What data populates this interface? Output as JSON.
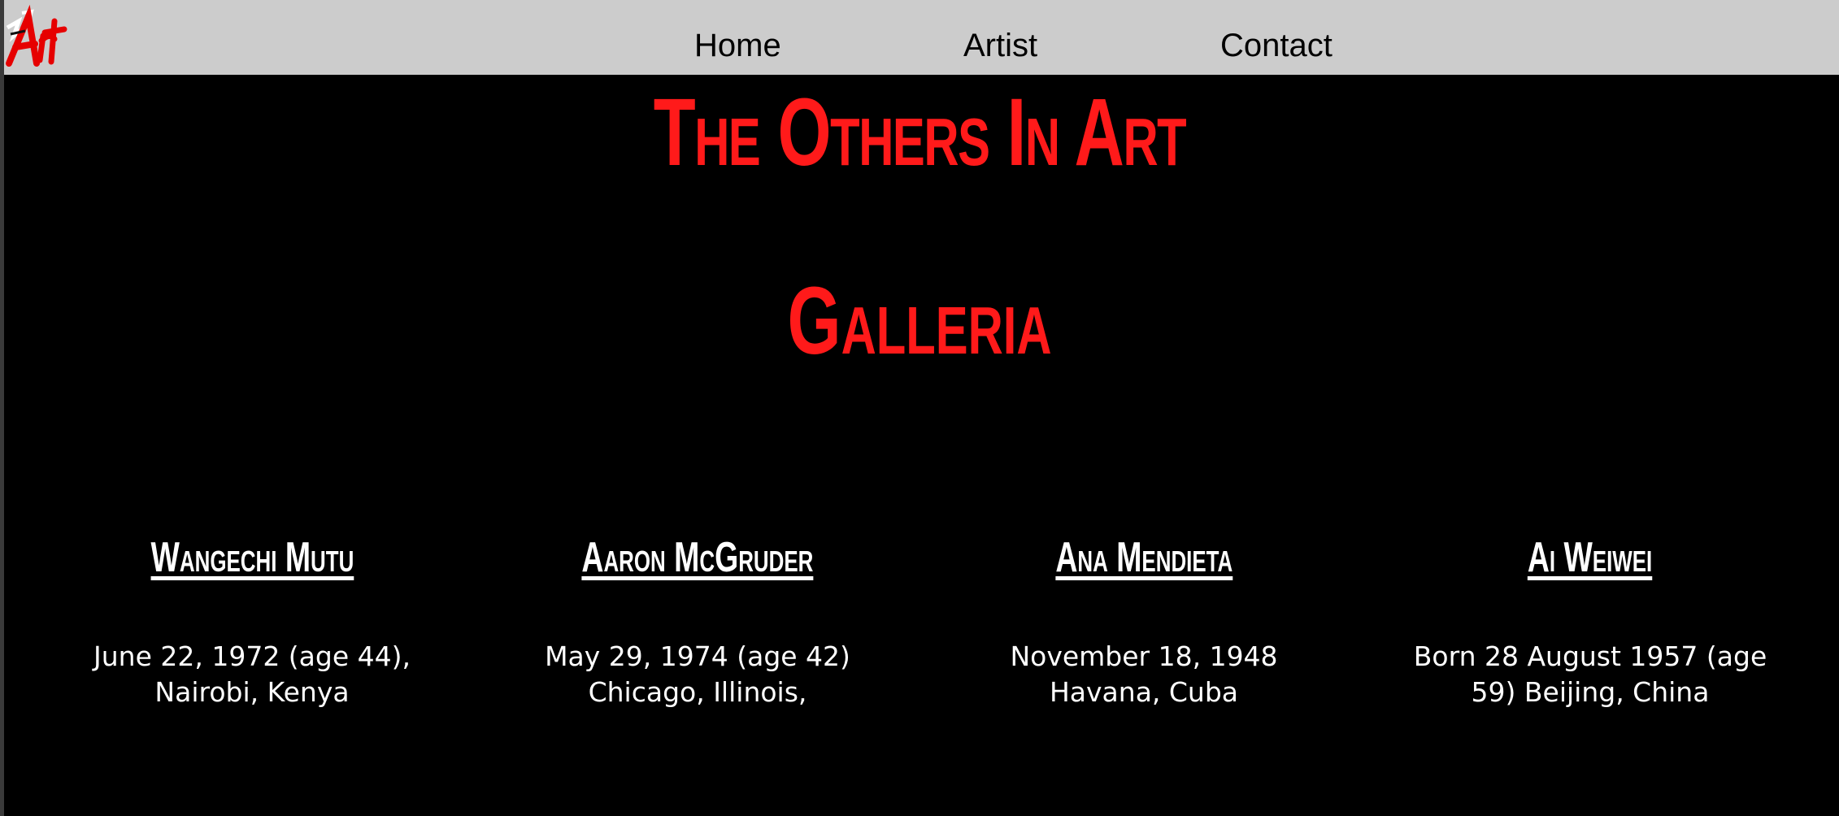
{
  "nav": {
    "logo_text": "Art",
    "links": [
      "Home",
      "Artist",
      "Contact"
    ]
  },
  "header": {
    "site_title": "The Others In Art",
    "section_title": "Galleria"
  },
  "artists": [
    {
      "name": "Wangechi Mutu",
      "info": "June 22, 1972 (age 44), Nairobi, Kenya"
    },
    {
      "name": "Aaron McGruder",
      "info": "May 29, 1974 (age 42) Chicago, Illinois,"
    },
    {
      "name": "Ana Mendieta",
      "info": "November 18, 1948 Havana, Cuba"
    },
    {
      "name": "Ai Weiwei",
      "info": "Born 28 August 1957 (age 59) Beijing, China"
    }
  ],
  "colors": {
    "accent": "#ff1a1a",
    "nav_bg": "#cccccc",
    "page_bg": "#000000",
    "text": "#ffffff"
  }
}
